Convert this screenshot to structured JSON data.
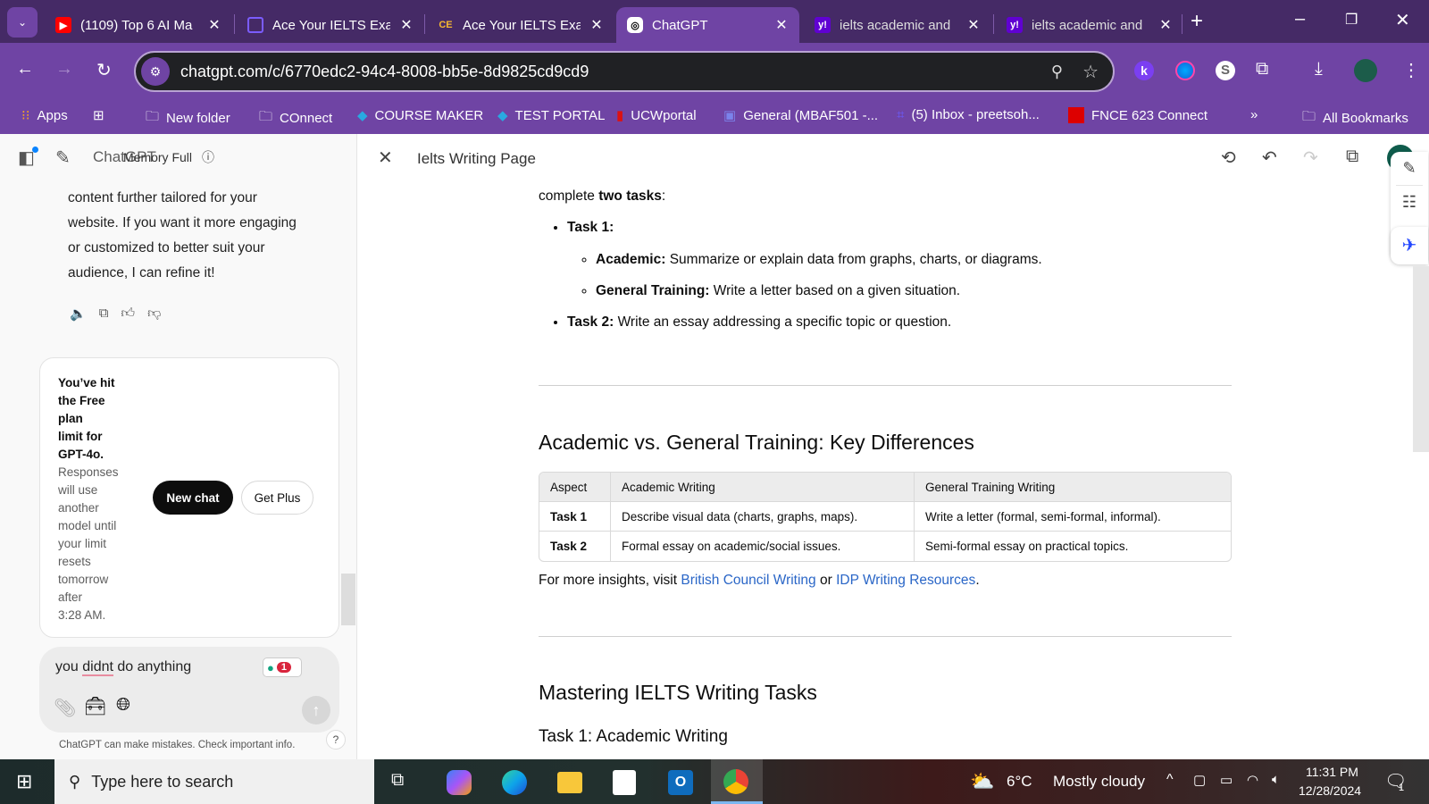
{
  "browser": {
    "tabs": [
      {
        "title": "(1109) Top 6 AI Ma",
        "icon": "youtube-icon"
      },
      {
        "title": "Ace Your IELTS Exa",
        "icon": "ielts-icon"
      },
      {
        "title": "Ace Your IELTS Exa",
        "icon": "ce-icon"
      },
      {
        "title": "ChatGPT",
        "icon": "chatgpt-icon",
        "active": true
      },
      {
        "title": "ielts academic and",
        "icon": "yahoo-icon"
      },
      {
        "title": "ielts academic and",
        "icon": "yahoo-icon"
      }
    ],
    "url": "chatgpt.com/c/6770edc2-94c4-8008-bb5e-8d9825cd9cd9",
    "bookmarks": [
      "Apps",
      "New folder",
      "COnnect",
      "COURSE MAKER",
      "TEST PORTAL",
      "UCWportal",
      "General (MBAF501 -...",
      "(5) Inbox - preetsoh...",
      "FNCE 623 Connect"
    ],
    "all_bookmarks": "All Bookmarks",
    "more": "»"
  },
  "chat": {
    "title": "ChatGPT",
    "memory": "Memory Full",
    "message_lines": [
      "content further tailored for your",
      "website. If you want it more engaging",
      "or customized to better suit your",
      "audience, I can refine it!"
    ],
    "limit": {
      "bold": [
        "You’ve hit",
        "the Free",
        "plan",
        "limit for",
        "GPT-4o."
      ],
      "text": [
        "Responses",
        "will use",
        "another",
        "model until",
        "your limit",
        "resets",
        "tomorrow",
        "after",
        "3:28 AM."
      ],
      "new_chat": "New chat",
      "get_plus": "Get Plus"
    },
    "input": {
      "pre": "you ",
      "misspelled": "didnt",
      "post": " do anything",
      "badge": "1"
    },
    "disclaimer": "ChatGPT can make mistakes. Check important info.",
    "help": "?"
  },
  "canvas": {
    "title": "Ielts Writing Page",
    "intro_pre": "complete ",
    "intro_bold": "two tasks",
    "intro_post": ":",
    "task1_label": "Task 1:",
    "academic_label": "Academic:",
    "academic_text": " Summarize or explain data from graphs, charts, or diagrams.",
    "gt_label": "General Training:",
    "gt_text": " Write a letter based on a given situation.",
    "task2_label": "Task 2:",
    "task2_text": " Write an essay addressing a specific topic or question.",
    "h2_diff": "Academic vs. General Training: Key Differences",
    "table": {
      "headers": [
        "Aspect",
        "Academic Writing",
        "General Training Writing"
      ],
      "rows": [
        [
          "Task 1",
          "Describe visual data (charts, graphs, maps).",
          "Write a letter (formal, semi-formal, informal)."
        ],
        [
          "Task 2",
          "Formal essay on academic/social issues.",
          "Semi-formal essay on practical topics."
        ]
      ]
    },
    "insights_pre": "For more insights, visit ",
    "link1": "British Council Writing",
    "insights_mid": " or ",
    "link2": "IDP Writing Resources",
    "insights_post": ".",
    "h2_master": "Mastering IELTS Writing Tasks",
    "h3_task1": "Task 1: Academic Writing"
  },
  "taskbar": {
    "search": "Type here to search",
    "weather_temp": "6°C",
    "weather_desc": "Mostly cloudy",
    "time": "11:31 PM",
    "date": "12/28/2024",
    "notifications": "1"
  }
}
